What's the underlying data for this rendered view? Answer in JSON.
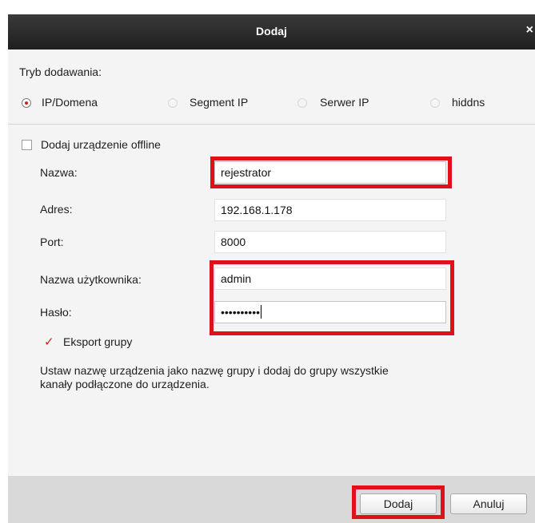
{
  "dialog": {
    "title": "Dodaj",
    "close_symbol": "×"
  },
  "mode": {
    "label": "Tryb dodawania:",
    "options": [
      {
        "label": "IP/Domena",
        "selected": true
      },
      {
        "label": "Segment IP",
        "selected": false
      },
      {
        "label": "Serwer IP",
        "selected": false
      },
      {
        "label": "hiddns",
        "selected": false
      }
    ]
  },
  "offline": {
    "label": "Dodaj urządzenie offline",
    "checked": false
  },
  "form": {
    "name": {
      "label": "Nazwa:",
      "value": "rejestrator"
    },
    "address": {
      "label": "Adres:",
      "value": "192.168.1.178"
    },
    "port": {
      "label": "Port:",
      "value": "8000"
    },
    "username": {
      "label": "Nazwa użytkownika:",
      "value": "admin"
    },
    "password": {
      "label": "Hasło:",
      "value": "••••••••••"
    }
  },
  "export_group": {
    "label": "Eksport grupy",
    "checked": true,
    "description_line1": "Ustaw nazwę urządzenia jako nazwę grupy i dodaj do grupy wszystkie",
    "description_line2": "kanały podłączone do urządzenia."
  },
  "buttons": {
    "add": "Dodaj",
    "cancel": "Anuluj"
  },
  "colors": {
    "accent": "#d81b1b",
    "highlight": "#e0101b",
    "titlebar": "#2b2b2b"
  }
}
